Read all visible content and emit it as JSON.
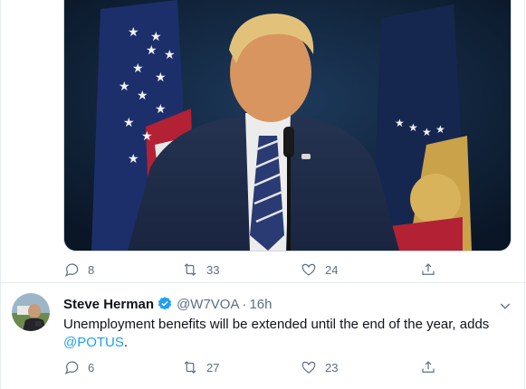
{
  "colors": {
    "accent": "#1da1f2",
    "text": "#0f1419",
    "muted": "#5b7083",
    "border": "#e6ecf0"
  },
  "tweet1": {
    "media": {
      "alt_icon": "press-photo-image"
    },
    "actions": {
      "replies": "8",
      "retweets": "33",
      "likes": "24"
    }
  },
  "tweet2": {
    "author": {
      "name": "Steve Herman",
      "handle": "@W7VOA",
      "separator": "·",
      "time": "16h",
      "verified": true
    },
    "text": "Unemployment benefits will be extended until the end of the year, adds",
    "mention": "@POTUS",
    "trailing": ".",
    "actions": {
      "replies": "6",
      "retweets": "27",
      "likes": "23"
    }
  }
}
